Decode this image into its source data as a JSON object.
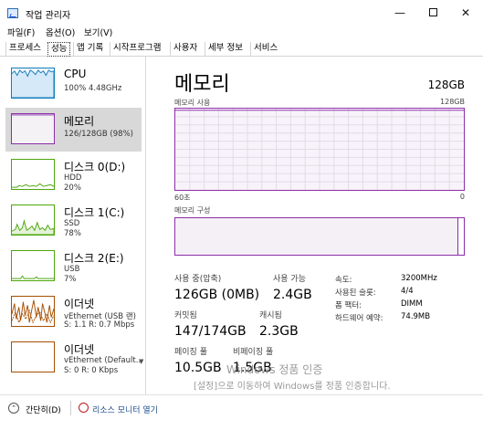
{
  "window": {
    "title": "작업 관리자",
    "minimize": "—",
    "close": "✕"
  },
  "menu": [
    "파일(F)",
    "옵션(O)",
    "보기(V)"
  ],
  "tabs": [
    "프로세스",
    "성능",
    "앱 기록",
    "시작프로그램",
    "사용자",
    "세부 정보",
    "서비스"
  ],
  "active_tab": "성능",
  "resources": [
    {
      "name": "CPU",
      "line1": "100%  4.48GHz",
      "line2": "",
      "line3": "",
      "color": "#117dbb",
      "icon": "cpu-graph"
    },
    {
      "name": "메모리",
      "line1": "126/128GB (98%)",
      "line2": "",
      "line3": "",
      "color": "#8b2ea8",
      "icon": "memory-graph"
    },
    {
      "name": "디스크 0(D:)",
      "line1": "HDD",
      "line2": "20%",
      "line3": "",
      "color": "#4da60c",
      "icon": "disk-graph"
    },
    {
      "name": "디스크 1(C:)",
      "line1": "SSD",
      "line2": "78%",
      "line3": "",
      "color": "#4da60c",
      "icon": "disk-graph"
    },
    {
      "name": "디스크 2(E:)",
      "line1": "USB",
      "line2": "7%",
      "line3": "",
      "color": "#4da60c",
      "icon": "disk-graph"
    },
    {
      "name": "이더넷",
      "line1": "vEthernet (USB 랜)",
      "line2": "S: 1.1  R: 0.7 Mbps",
      "line3": "",
      "color": "#a74f01",
      "icon": "ethernet-graph"
    },
    {
      "name": "이더넷",
      "line1": "vEthernet (Default...",
      "line2": "S: 0  R: 0 Kbps",
      "line3": "",
      "color": "#a74f01",
      "icon": "ethernet-graph"
    }
  ],
  "main": {
    "title": "메모리",
    "total": "128GB",
    "usage_label": "메모리 사용",
    "usage_max": "128GB",
    "usage_time": "60초",
    "usage_zero": "0",
    "usage_fraction": 0.98,
    "composition_label": "메모리 구성",
    "color": "#8b2ea8"
  },
  "stats": {
    "in_use_label": "사용 중(압축)",
    "in_use_value": "126GB (0MB)",
    "available_label": "사용 가능",
    "available_value": "2.4GB",
    "committed_label": "커밋됨",
    "committed_value": "147/174GB",
    "cached_label": "캐시됨",
    "cached_value": "2.3GB",
    "paged_label": "페이징 풀",
    "paged_value": "10.5GB",
    "nonpaged_label": "비페이징 풀",
    "nonpaged_value": "1.5GB"
  },
  "details": [
    {
      "label": "속도:",
      "value": "3200MHz"
    },
    {
      "label": "사용된 슬롯:",
      "value": "4/4"
    },
    {
      "label": "폼 팩터:",
      "value": "DIMM"
    },
    {
      "label": "하드웨어 예약:",
      "value": "74.9MB"
    }
  ],
  "watermark": {
    "title": "Windows 정품 인증",
    "subtitle": "[설정]으로 이동하여 Windows를 정품 인증합니다."
  },
  "footer": {
    "brief": "간단히(D)",
    "monitor": "리소스 모니터 열기"
  }
}
